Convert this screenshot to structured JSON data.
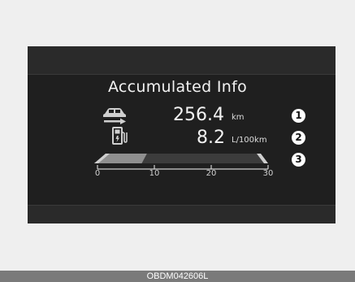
{
  "screen": {
    "title": "Accumulated Info"
  },
  "distance": {
    "icon": "car-arrow-icon",
    "value": "256.4",
    "unit": "km",
    "marker": "1"
  },
  "fuel_economy": {
    "icon": "fuel-pump-icon",
    "value": "8.2",
    "unit": "L/100km",
    "marker": "2"
  },
  "gauge": {
    "marker": "3",
    "scale_labels": [
      "0",
      "10",
      "20",
      "30"
    ],
    "scale_max": 30,
    "level_value": 8.2,
    "colors": {
      "filled": "#8f8f8f",
      "empty": "#3c3c3c",
      "end_caps": "#cfcfcf"
    }
  },
  "caption": "OBDM042606L"
}
